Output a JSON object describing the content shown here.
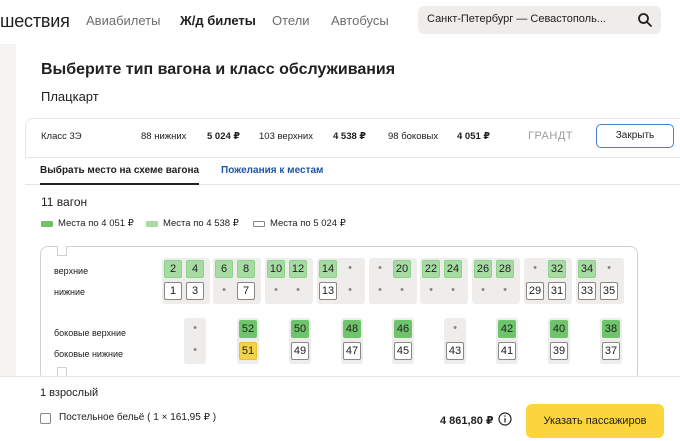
{
  "header": {
    "logo": "шествия",
    "nav": [
      {
        "label": "Авиабилеты",
        "active": false
      },
      {
        "label": "Ж/д билеты",
        "active": true
      },
      {
        "label": "Отели",
        "active": false
      },
      {
        "label": "Автобусы",
        "active": false
      }
    ],
    "search": {
      "value": "Санкт-Петербург — Севастополь..."
    }
  },
  "page": {
    "title": "Выберите тип вагона и класс обслуживания",
    "car_type": "Плацкарт"
  },
  "class_row": {
    "class_label": "Класс 3Э",
    "lower_count": "88 нижних",
    "lower_price": "5 024 ₽",
    "upper_count": "103 верхних",
    "upper_price": "4 538 ₽",
    "side_count": "98 боковых",
    "side_price": "4 051 ₽",
    "carrier": "ГРАНДТ",
    "close_label": "Закрыть"
  },
  "tabs": {
    "scheme": "Выбрать место на схеме вагона",
    "wishes": "Пожелания к местам"
  },
  "wagon_title": "11 вагон",
  "legend": [
    {
      "label": "Места по 4 051 ₽",
      "color": "#6ec46a"
    },
    {
      "label": "Места по 4 538 ₽",
      "color": "#a6dba3"
    },
    {
      "label": "Места по 5 024 ₽",
      "color": "#ffffff"
    }
  ],
  "scheme": {
    "row_labels": {
      "upper": "верхние",
      "lower": "нижние",
      "side_upper": "боковые верхние",
      "side_lower": "боковые нижние"
    },
    "compartments": [
      {
        "upper": [
          "2",
          "4"
        ],
        "lower": [
          "1",
          "3"
        ]
      },
      {
        "upper": [
          "6",
          "8"
        ],
        "lower": [
          "•",
          "7"
        ]
      },
      {
        "upper": [
          "10",
          "12"
        ],
        "lower": [
          "•",
          "•"
        ]
      },
      {
        "upper": [
          "14",
          "•"
        ],
        "lower": [
          "13",
          "•"
        ]
      },
      {
        "upper": [
          "•",
          "20"
        ],
        "lower": [
          "•",
          "•"
        ]
      },
      {
        "upper": [
          "22",
          "24"
        ],
        "lower": [
          "•",
          "•"
        ]
      },
      {
        "upper": [
          "26",
          "28"
        ],
        "lower": [
          "•",
          "•"
        ]
      },
      {
        "upper": [
          "•",
          "32"
        ],
        "lower": [
          "29",
          "31"
        ]
      },
      {
        "upper": [
          "34",
          "•"
        ],
        "lower": [
          "33",
          "35"
        ]
      }
    ],
    "side": [
      {
        "upper": "•",
        "lower": "•"
      },
      {
        "upper": "52",
        "lower": "51"
      },
      {
        "upper": "50",
        "lower": "49"
      },
      {
        "upper": "48",
        "lower": "47"
      },
      {
        "upper": "46",
        "lower": "45"
      },
      {
        "upper": "•",
        "lower": "43"
      },
      {
        "upper": "42",
        "lower": "41"
      },
      {
        "upper": "40",
        "lower": "39"
      },
      {
        "upper": "38",
        "lower": "37"
      }
    ]
  },
  "footer": {
    "passengers": "1 взрослый",
    "linen": "Постельное бельё ( 1 × 161,95 ₽ )",
    "total": "4 861,80 ₽",
    "cta": "Указать пассажиров"
  },
  "colors": {
    "accent_yellow": "#fcd43c",
    "seat_side_price": "#6ec46a",
    "seat_upper_price": "#a6dba3",
    "selected_seat": "#f3d246",
    "link_blue": "#1e55a5"
  }
}
